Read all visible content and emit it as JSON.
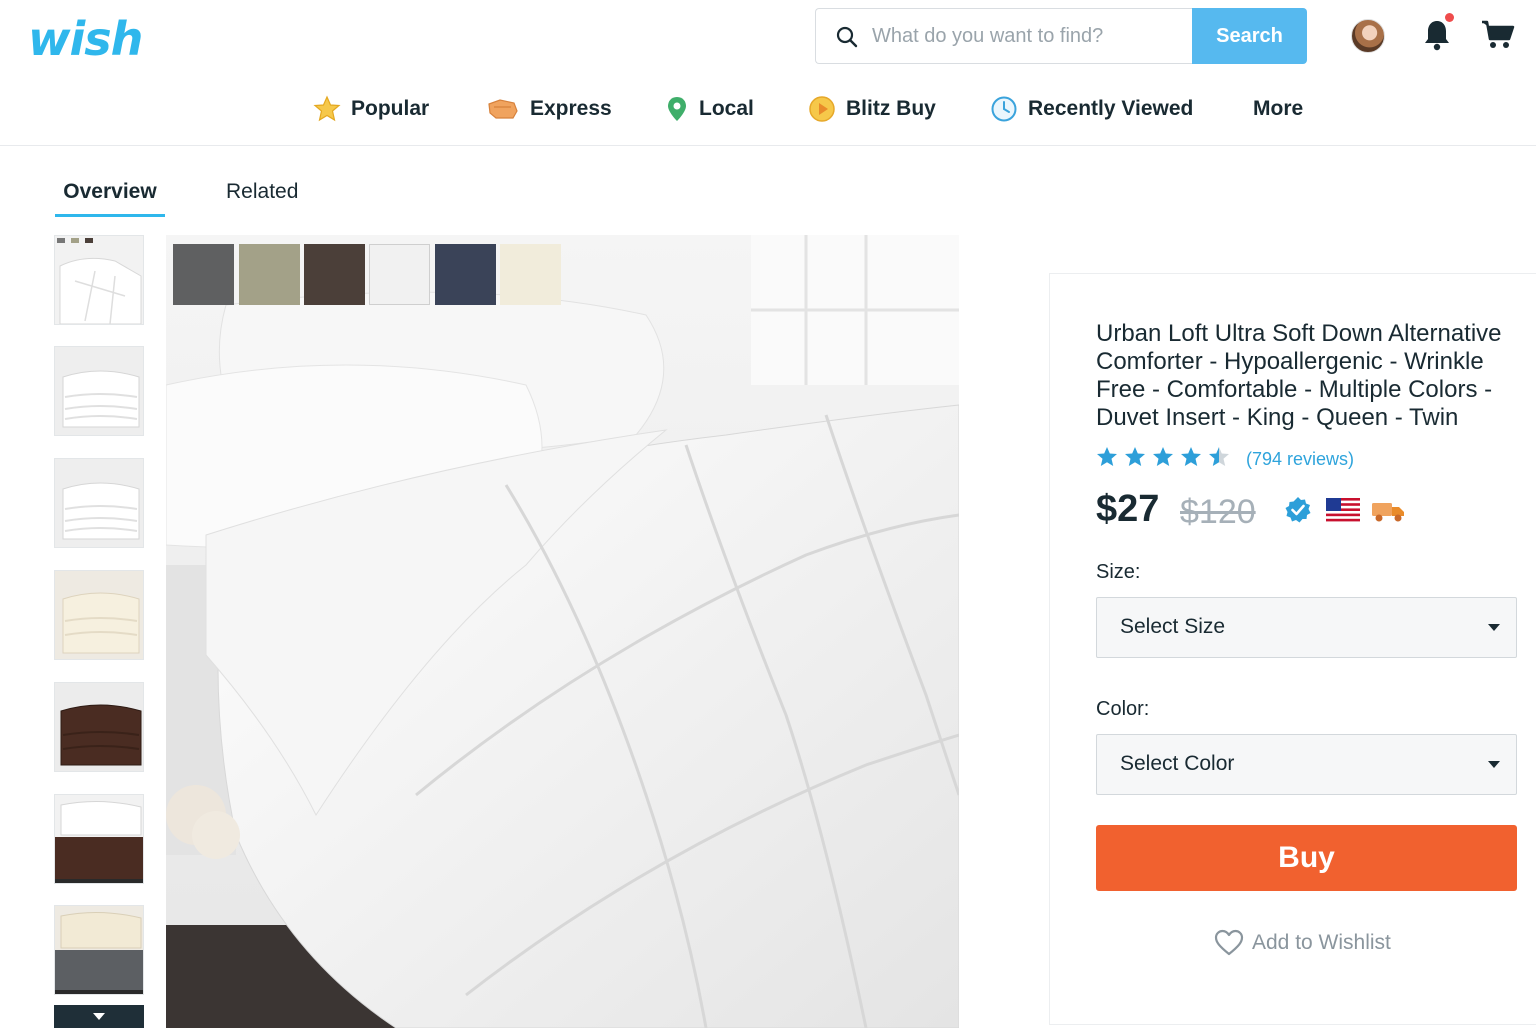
{
  "header": {
    "logo": "wish",
    "search": {
      "placeholder": "What do you want to find?",
      "value": "",
      "button_label": "Search"
    },
    "icons": [
      "user-avatar",
      "bell-icon",
      "cart-icon"
    ]
  },
  "nav": {
    "items": [
      {
        "label": "Popular",
        "icon": "star-icon"
      },
      {
        "label": "Express",
        "icon": "express-icon"
      },
      {
        "label": "Local",
        "icon": "location-pin-icon"
      },
      {
        "label": "Blitz Buy",
        "icon": "blitz-buy-icon"
      },
      {
        "label": "Recently Viewed",
        "icon": "clock-icon"
      },
      {
        "label": "More",
        "icon": ""
      }
    ]
  },
  "tabs": [
    {
      "label": "Overview",
      "active": true
    },
    {
      "label": "Related",
      "active": false
    }
  ],
  "gallery": {
    "thumbnails": [
      "white-comforter",
      "white-folded",
      "white-folded-2",
      "ivory-folded",
      "chocolate-folded",
      "white-chocolate-combo",
      "ivory-gray-combo"
    ],
    "swatch_colors": [
      "#5f6061",
      "#a3a188",
      "#4b3f39",
      "#f1f1f1",
      "#3a4358",
      "#f1ecdb"
    ]
  },
  "product": {
    "title": "Urban Loft Ultra Soft Down Alternative Comforter - Hypoallergenic - Wrinkle Free - Comfortable - Multiple Colors - Duvet Insert - King - Queen - Twin",
    "rating": 4.5,
    "rating_max": 5,
    "reviews": "(794 reviews)",
    "price": "$27",
    "original_price": "$120",
    "badges": [
      "verified-icon",
      "us-flag-icon",
      "delivery-truck-icon"
    ],
    "size_label": "Size:",
    "size_select": "Select Size",
    "color_label": "Color:",
    "color_select": "Select Color",
    "buy_label": "Buy",
    "wishlist_label": "Add to Wishlist"
  },
  "colors": {
    "brand": "#2fb7ec",
    "search_button": "#56b9ef",
    "buy_button": "#f1612f",
    "star": "#2d9fd9",
    "link": "#2fa4dc"
  }
}
